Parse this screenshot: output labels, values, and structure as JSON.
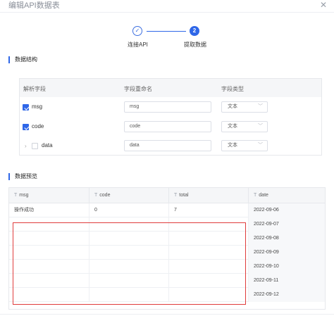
{
  "dialog": {
    "title": "编辑API数据表",
    "close_glyph": "✕"
  },
  "stepper": {
    "steps": [
      {
        "label": "连接API",
        "status": "done",
        "glyph": "✓"
      },
      {
        "label": "提取数据",
        "status": "active",
        "number": "2"
      }
    ]
  },
  "structure": {
    "title": "数据结构",
    "columns": [
      "解析字段",
      "字段重命名",
      "字段类型"
    ],
    "rows": [
      {
        "name": "msg",
        "checked": true,
        "rename": "msg",
        "type": "文本"
      },
      {
        "name": "code",
        "checked": true,
        "rename": "code",
        "type": "文本"
      },
      {
        "name": "data",
        "checked": false,
        "expandable": true,
        "rename": "data",
        "type": "文本"
      }
    ]
  },
  "preview": {
    "title": "数据预览",
    "type_glyph": "T",
    "columns": [
      "msg",
      "code",
      "total",
      "date"
    ],
    "rows": [
      [
        "操作成功",
        "0",
        "7",
        "2022-09-06"
      ],
      [
        "",
        "",
        "",
        "2022-09-07"
      ],
      [
        "",
        "",
        "",
        "2022-09-08"
      ],
      [
        "",
        "",
        "",
        "2022-09-09"
      ],
      [
        "",
        "",
        "",
        "2022-09-10"
      ],
      [
        "",
        "",
        "",
        "2022-09-11"
      ],
      [
        "",
        "",
        "",
        "2022-09-12"
      ]
    ]
  },
  "colors": {
    "accent": "#2f67e8",
    "highlight": "#e03c3c"
  }
}
